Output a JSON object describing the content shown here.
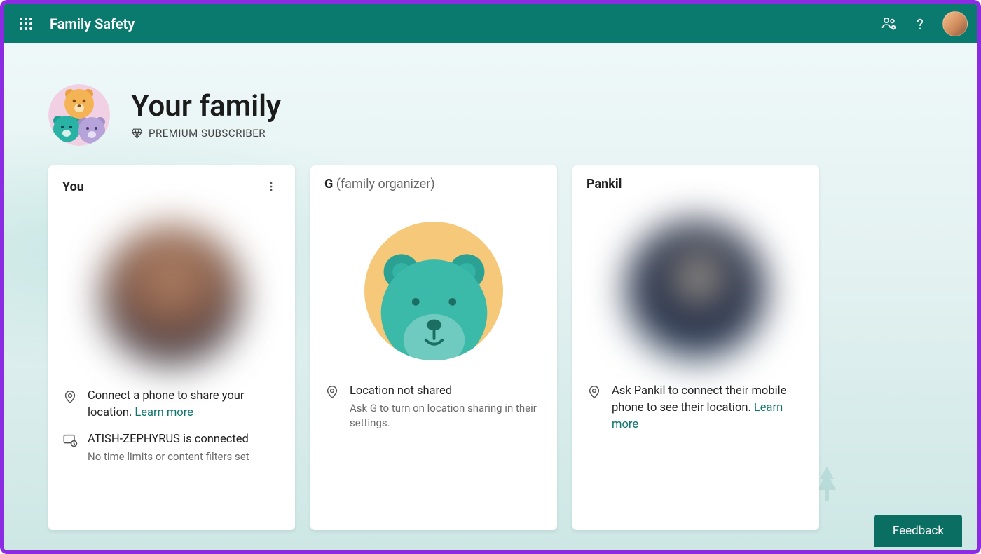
{
  "header": {
    "app_title": "Family Safety"
  },
  "page": {
    "title": "Your family",
    "subscriber_label": "PREMIUM SUBSCRIBER"
  },
  "cards": [
    {
      "name": "You",
      "role": "",
      "has_more_menu": true,
      "avatar_type": "blur1",
      "rows": [
        {
          "icon": "location",
          "text": "Connect a phone to share your location. ",
          "link": "Learn more",
          "sub": ""
        },
        {
          "icon": "device",
          "text": "ATISH-ZEPHYRUS is connected",
          "link": "",
          "sub": "No time limits or content filters set"
        }
      ]
    },
    {
      "name": "G",
      "role": "(family organizer)",
      "has_more_menu": false,
      "avatar_type": "bear",
      "rows": [
        {
          "icon": "location",
          "text": "Location not shared",
          "link": "",
          "sub": "Ask G to turn on location sharing in their settings."
        }
      ]
    },
    {
      "name": "Pankil",
      "role": "",
      "has_more_menu": false,
      "avatar_type": "blur3",
      "rows": [
        {
          "icon": "location",
          "text": "Ask Pankil to connect their mobile phone to see their location. ",
          "link": "Learn more",
          "sub": ""
        }
      ]
    }
  ],
  "feedback_label": "Feedback",
  "colors": {
    "brand": "#0a7a6e",
    "link": "#0f766e",
    "frame": "#8b2be2"
  }
}
